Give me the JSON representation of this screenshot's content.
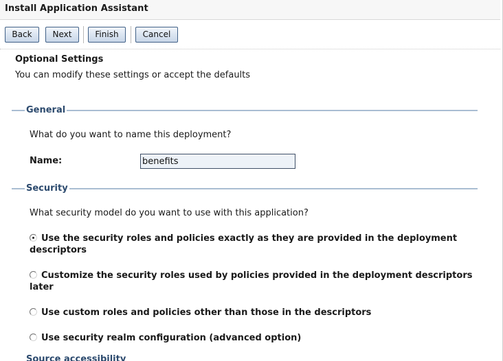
{
  "window": {
    "title": "Install Application Assistant"
  },
  "toolbar": {
    "back_label": "Back",
    "next_label": "Next",
    "finish_label": "Finish",
    "cancel_label": "Cancel"
  },
  "page": {
    "heading": "Optional Settings",
    "description": "You can modify these settings or accept the defaults"
  },
  "general": {
    "legend": "General",
    "question": "What do you want to name this deployment?",
    "name_label": "Name:",
    "name_value": "benefits"
  },
  "security": {
    "legend": "Security",
    "question": "What security model do you want to use with this application?",
    "options": [
      {
        "label": "Use the security roles and policies exactly as they are provided in the deployment descriptors",
        "selected": true
      },
      {
        "label": "Customize the security roles used by policies provided in the deployment descriptors later",
        "selected": false
      },
      {
        "label": "Use custom roles and policies other than those in the descriptors",
        "selected": false
      },
      {
        "label": "Use security realm configuration (advanced option)",
        "selected": false
      }
    ]
  },
  "next_section": {
    "legend_partial": "Source accessibility"
  },
  "colors": {
    "legend_text": "#2c4a6e",
    "legend_line": "#a9bdd2",
    "button_border": "#3f5f86",
    "input_bg": "#edf2f8"
  }
}
